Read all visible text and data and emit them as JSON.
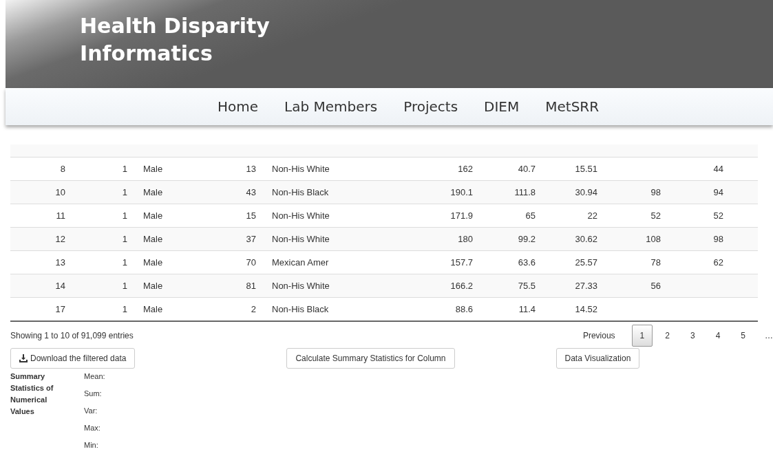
{
  "header": {
    "title_lines": [
      "Health Disparity",
      "Informatics"
    ]
  },
  "nav": [
    {
      "label": "Home"
    },
    {
      "label": "Lab Members"
    },
    {
      "label": "Projects"
    },
    {
      "label": "DIEM"
    },
    {
      "label": "MetSRR"
    }
  ],
  "table": {
    "rows": [
      [
        "8",
        "1",
        "Male",
        "13",
        "Non-His White",
        "162",
        "40.7",
        "15.51",
        "",
        "44"
      ],
      [
        "10",
        "1",
        "Male",
        "43",
        "Non-His Black",
        "190.1",
        "111.8",
        "30.94",
        "98",
        "94"
      ],
      [
        "11",
        "1",
        "Male",
        "15",
        "Non-His White",
        "171.9",
        "65",
        "22",
        "52",
        "52"
      ],
      [
        "12",
        "1",
        "Male",
        "37",
        "Non-His White",
        "180",
        "99.2",
        "30.62",
        "108",
        "98"
      ],
      [
        "13",
        "1",
        "Male",
        "70",
        "Mexican Amer",
        "157.7",
        "63.6",
        "25.57",
        "78",
        "62"
      ],
      [
        "14",
        "1",
        "Male",
        "81",
        "Non-His White",
        "166.2",
        "75.5",
        "27.33",
        "56",
        ""
      ],
      [
        "17",
        "1",
        "Male",
        "2",
        "Non-His Black",
        "88.6",
        "11.4",
        "14.52",
        "",
        ""
      ]
    ]
  },
  "info": "Showing 1 to 10 of 91,099 entries",
  "pagination": {
    "previous": "Previous",
    "pages": [
      {
        "label": "1",
        "selected": true
      },
      {
        "label": "2",
        "selected": false
      },
      {
        "label": "3",
        "selected": false
      },
      {
        "label": "4",
        "selected": false
      },
      {
        "label": "5",
        "selected": false
      }
    ],
    "ellipsis": "…"
  },
  "buttons": {
    "download": "Download the filtered data",
    "calculate": "Calculate Summary Statistics for Column",
    "visualize": "Data Visualization"
  },
  "summary": {
    "title": "Summary Statistics of Numerical Values",
    "labels": [
      "Mean:",
      "Sum:",
      "Var:",
      "Max:",
      "Min:"
    ]
  }
}
